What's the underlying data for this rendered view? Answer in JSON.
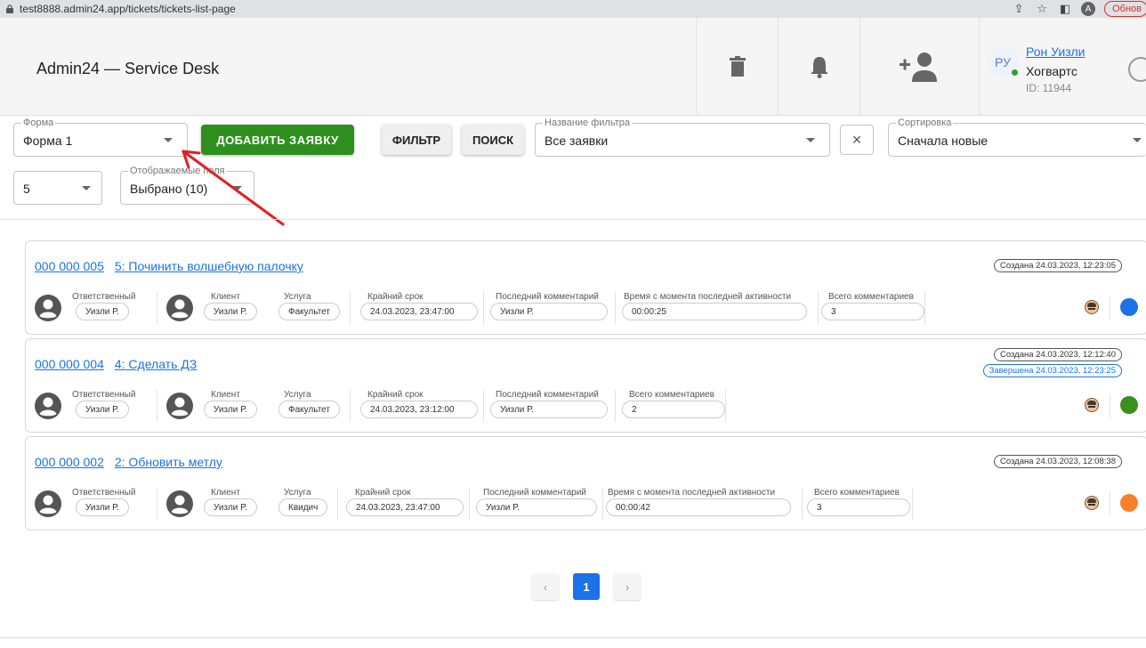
{
  "browser": {
    "url": "test8888.admin24.app/tickets/tickets-list-page",
    "profile_initial": "A",
    "update_label": "Обнов"
  },
  "header": {
    "title": "Admin24 — Service Desk",
    "user": {
      "initials": "РУ",
      "name": "Рон Уизли",
      "org": "Хогвартс",
      "id": "ID: 11944"
    }
  },
  "filters": {
    "form": {
      "label": "Форма",
      "value": "Форма 1"
    },
    "add_button": "ДОБАВИТЬ ЗАЯВКУ",
    "filter_button": "ФИЛЬТР",
    "search_button": "ПОИСК",
    "filter_name": {
      "label": "Название фильтра",
      "value": "Все заявки"
    },
    "clear_symbol": "×",
    "sort": {
      "label": "Сортировка",
      "value": "Сначала новые"
    },
    "per_page": {
      "value": "5"
    },
    "fields": {
      "label": "Отображаемые поля",
      "value": "Выбрано (10)"
    }
  },
  "labels": {
    "responsible": "Ответственный",
    "client": "Клиент",
    "service": "Услуга",
    "deadline": "Крайний срок",
    "last_comment": "Последний комментарий",
    "since_activity": "Время с момента последней активности",
    "total_comments": "Всего комментариев"
  },
  "tickets": [
    {
      "number": "000 000 005",
      "title": "5: Починить волшебную палочку",
      "created": "Создана 24.03.2023, 12:23:05",
      "completed": "",
      "responsible": "Уизли Р.",
      "client": "Уизли Р.",
      "service": "Факультет",
      "deadline": "24.03.2023, 23:47:00",
      "last_comment": "Уизли Р.",
      "since_activity": "00:00:25",
      "total_comments": "3",
      "status_color": "#1a73e8"
    },
    {
      "number": "000 000 004",
      "title": "4: Сделать ДЗ",
      "created": "Создана 24.03.2023, 12:12:40",
      "completed": "Завершена 24.03.2023, 12:23:25",
      "responsible": "Уизли Р.",
      "client": "Уизли Р.",
      "service": "Факультет",
      "deadline": "24.03.2023, 23:12:00",
      "last_comment": "Уизли Р.",
      "since_activity": "",
      "total_comments": "2",
      "status_color": "#3a8f1f"
    },
    {
      "number": "000 000 002",
      "title": "2: Обновить метлу",
      "created": "Создана 24.03.2023, 12:08:38",
      "completed": "",
      "responsible": "Уизли Р.",
      "client": "Уизли Р.",
      "service": "Квидич",
      "deadline": "24.03.2023, 23:47:00",
      "last_comment": "Уизли Р.",
      "since_activity": "00:00:42",
      "total_comments": "3",
      "status_color": "#f5822a"
    }
  ],
  "pagination": {
    "prev": "‹",
    "current": "1",
    "next": "›"
  }
}
